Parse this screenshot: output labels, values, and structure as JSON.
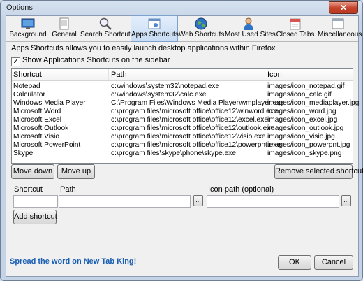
{
  "window": {
    "title": "Options",
    "close_glyph": "✕"
  },
  "tabs": [
    {
      "label": "Background",
      "icon": "monitor-icon"
    },
    {
      "label": "General",
      "icon": "document-icon"
    },
    {
      "label": "Search Shortcuts",
      "icon": "magnifier-icon"
    },
    {
      "label": "Apps Shortcuts",
      "icon": "apps-icon",
      "active": true
    },
    {
      "label": "Web Shortcuts",
      "icon": "globe-icon"
    },
    {
      "label": "Most Used Sites",
      "icon": "person-icon"
    },
    {
      "label": "Closed Tabs",
      "icon": "calendar-icon"
    },
    {
      "label": "Miscellaneous",
      "icon": "window-icon"
    }
  ],
  "apps": {
    "description": "Apps Shortcuts allows you to easily launch desktop applications within Firefox",
    "show_sidebar_label": "Show Applications Shortcuts on the sidebar",
    "show_sidebar_checked": true,
    "columns": [
      "Shortcut",
      "Path",
      "Icon"
    ],
    "rows": [
      [
        "Notepad",
        "c:\\windows\\system32\\notepad.exe",
        "images/icon_notepad.gif"
      ],
      [
        "Calculator",
        "c:\\windows\\system32\\calc.exe",
        "images/icon_calc.gif"
      ],
      [
        "Windows Media Player",
        "C:\\Program Files\\Windows Media Player\\wmplayer.exe",
        "images/icon_mediaplayer.jpg"
      ],
      [
        "Microsoft Word",
        "c:\\program files\\microsoft office\\office12\\winword.exe",
        "images/icon_word.jpg"
      ],
      [
        "Microsoft Excel",
        "c:\\program files\\microsoft office\\office12\\excel.exe",
        "images/icon_excel.jpg"
      ],
      [
        "Microsoft Outlook",
        "c:\\program files\\microsoft office\\office12\\outlook.exe",
        "images/icon_outlook.jpg"
      ],
      [
        "Microsoft Visio",
        "c:\\program files\\microsoft office\\office12\\visio.exe",
        "images/icon_visio.jpg"
      ],
      [
        "Microsoft PowerPoint",
        "c:\\program files\\microsoft office\\office12\\powerpnt.exe",
        "images/icon_powerpnt.jpg"
      ],
      [
        "Skype",
        "c:\\program files\\skype\\phone\\skype.exe",
        "images/icon_skype.png"
      ]
    ],
    "move_down_label": "Move down",
    "move_up_label": "Move up",
    "remove_label": "Remove selected shortcuts",
    "shortcut_label": "Shortcut",
    "path_label": "Path",
    "icon_path_label": "Icon path (optional)",
    "browse_label": "...",
    "add_label": "Add shortcut"
  },
  "footer": {
    "spread_text": "Spread the word on New Tab King!",
    "ok_label": "OK",
    "cancel_label": "Cancel"
  },
  "colors": {
    "accent_link": "#1a5fb4",
    "close_red": "#c7442c"
  }
}
